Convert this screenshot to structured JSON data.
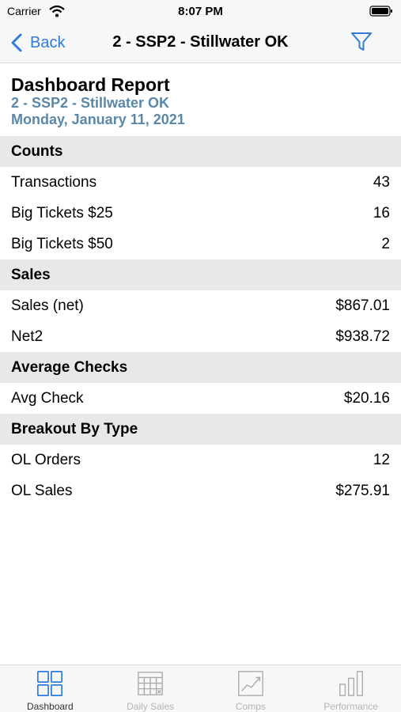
{
  "status_bar": {
    "carrier": "Carrier",
    "time": "8:07 PM"
  },
  "nav": {
    "back_label": "Back",
    "title": "2 - SSP2 - Stillwater OK"
  },
  "report": {
    "title": "Dashboard Report",
    "location": "2 - SSP2 - Stillwater OK",
    "date": "Monday, January 11, 2021"
  },
  "sections": [
    {
      "header": "Counts",
      "rows": [
        {
          "label": "Transactions",
          "value": "43"
        },
        {
          "label": "Big Tickets $25",
          "value": "16"
        },
        {
          "label": "Big Tickets $50",
          "value": "2"
        }
      ]
    },
    {
      "header": "Sales",
      "rows": [
        {
          "label": "Sales (net)",
          "value": "$867.01"
        },
        {
          "label": "Net2",
          "value": "$938.72"
        }
      ]
    },
    {
      "header": "Average Checks",
      "rows": [
        {
          "label": "Avg Check",
          "value": "$20.16"
        }
      ]
    },
    {
      "header": "Breakout By Type",
      "rows": [
        {
          "label": "OL Orders",
          "value": "12"
        },
        {
          "label": "OL Sales",
          "value": "$275.91"
        }
      ]
    }
  ],
  "tabs": [
    {
      "label": "Dashboard",
      "icon": "grid-icon",
      "active": true
    },
    {
      "label": "Daily Sales",
      "icon": "calendar-icon",
      "active": false
    },
    {
      "label": "Comps",
      "icon": "trend-chart-icon",
      "active": false
    },
    {
      "label": "Performance",
      "icon": "bar-chart-icon",
      "active": false
    }
  ],
  "colors": {
    "accent": "#2f7bd9",
    "subtitle": "#5b87a8",
    "section_bg": "#e8e8e8",
    "tab_inactive": "#b4b4b4"
  }
}
